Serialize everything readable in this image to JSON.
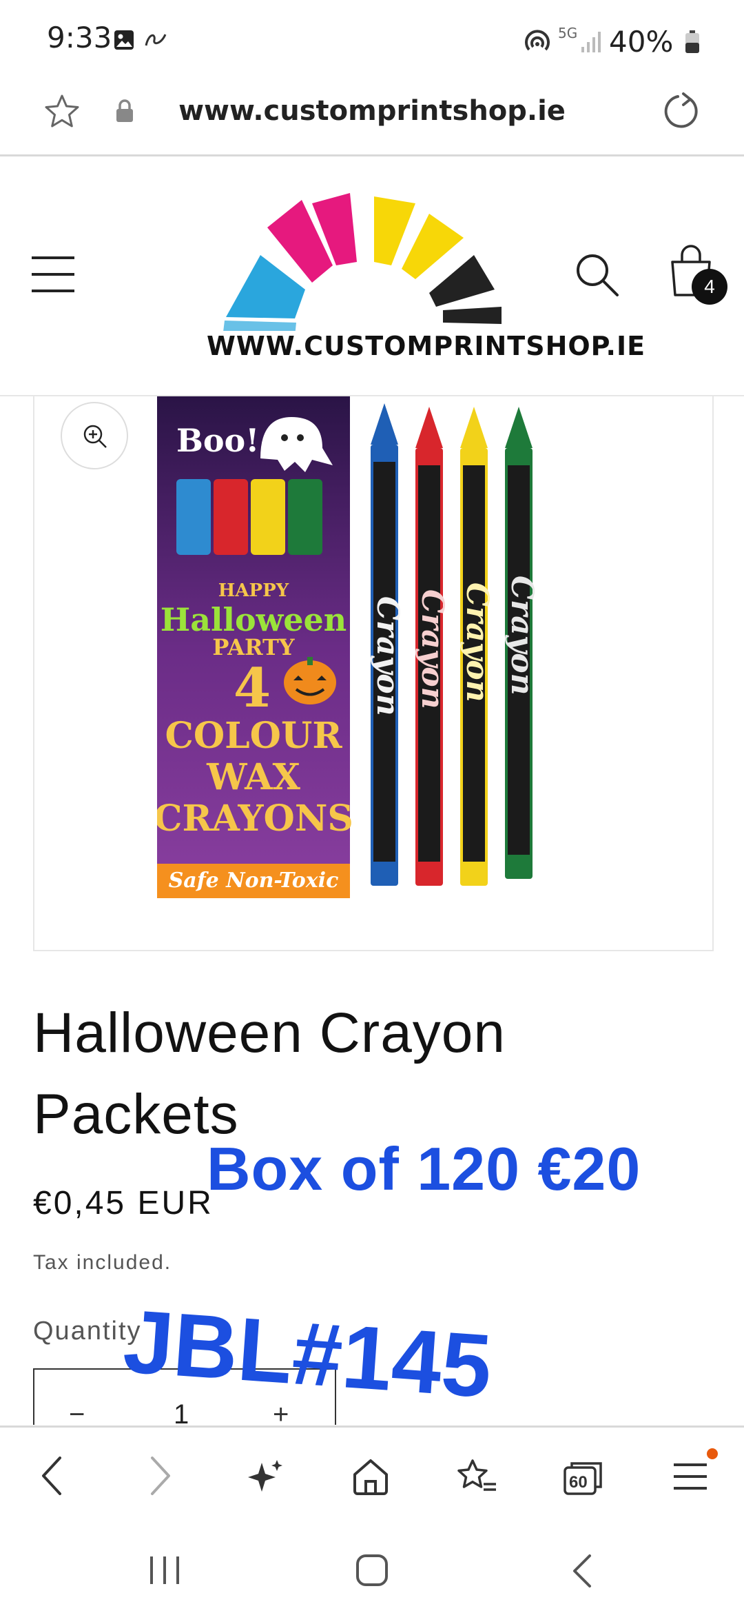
{
  "status_bar": {
    "time": "9:33",
    "network": "5G",
    "battery": "40%"
  },
  "browser": {
    "url": "www.customprintshop.ie",
    "tab_count": "60"
  },
  "site": {
    "logo_text": "WWW.CUSTOMPRINTSHOP.IE",
    "cart_count": "4"
  },
  "product_image": {
    "box_texts": [
      "Boo!",
      "HAPPY",
      "Halloween",
      "PARTY",
      "4",
      "COLOUR",
      "WAX",
      "CRAYONS",
      "Safe Non-Toxic"
    ],
    "crayon_label": "Crayon",
    "crayon_colors": [
      "#1f5fb5",
      "#d8262c",
      "#f2d21a",
      "#1e7a3a"
    ]
  },
  "product": {
    "title_line1": "Halloween Crayon",
    "title_line2": "Packets",
    "price": "€0,45 EUR",
    "tax_note": "Tax included.",
    "quantity_label": "Quantity",
    "quantity_value": "1",
    "minus": "−",
    "plus": "+"
  },
  "overlays": {
    "box_offer": "Box of 120 €20",
    "code": "JBL#145"
  },
  "colors": {
    "overlay_blue": "#1c4fe0",
    "logo_magenta": "#e6197e",
    "logo_yellow": "#f7d708",
    "logo_cyan": "#2aa6dd",
    "notification_dot": "#e8590c"
  }
}
